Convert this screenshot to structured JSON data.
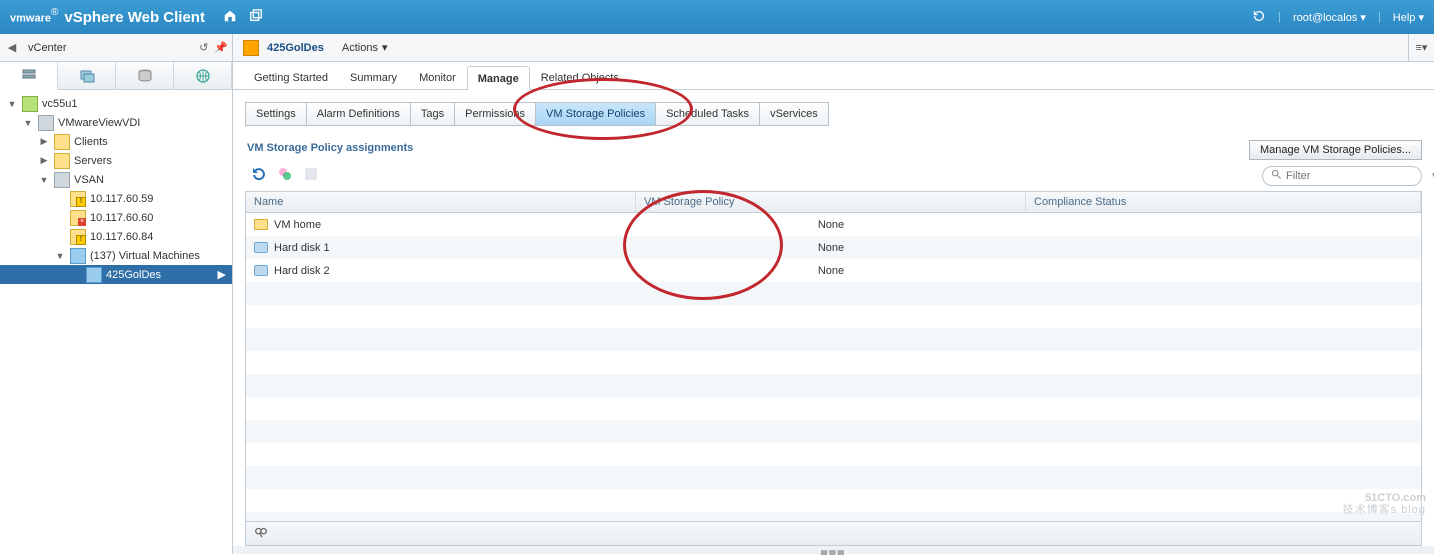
{
  "header": {
    "brand_prefix": "vm",
    "brand_suffix": "ware",
    "brand_reg": "®",
    "title": "vSphere Web Client",
    "user": "root@localos",
    "help": "Help"
  },
  "nav": {
    "back_label": "vCenter",
    "object_name": "425GolDes",
    "actions": "Actions"
  },
  "tree": [
    {
      "depth": 0,
      "tw": "▼",
      "icon": "ic-vc",
      "label": "vc55u1"
    },
    {
      "depth": 1,
      "tw": "▼",
      "icon": "ic-dc",
      "label": "VMwareViewVDI"
    },
    {
      "depth": 2,
      "tw": "▶",
      "icon": "ic-folder",
      "label": "Clients"
    },
    {
      "depth": 2,
      "tw": "▶",
      "icon": "ic-folder",
      "label": "Servers"
    },
    {
      "depth": 2,
      "tw": "▼",
      "icon": "ic-cluster",
      "label": "VSAN"
    },
    {
      "depth": 3,
      "tw": "",
      "icon": "ic-host warn",
      "label": "10.117.60.59"
    },
    {
      "depth": 3,
      "tw": "",
      "icon": "ic-host err",
      "label": "10.117.60.60"
    },
    {
      "depth": 3,
      "tw": "",
      "icon": "ic-host warn",
      "label": "10.117.60.84"
    },
    {
      "depth": 3,
      "tw": "▼",
      "icon": "ic-vmfolder",
      "label": "(137) Virtual Machines"
    },
    {
      "depth": 4,
      "tw": "",
      "icon": "ic-vm",
      "label": "425GolDes",
      "selected": true
    }
  ],
  "tabs1": [
    {
      "label": "Getting Started"
    },
    {
      "label": "Summary"
    },
    {
      "label": "Monitor"
    },
    {
      "label": "Manage",
      "active": true
    },
    {
      "label": "Related Objects"
    }
  ],
  "tabs2": [
    {
      "label": "Settings"
    },
    {
      "label": "Alarm Definitions"
    },
    {
      "label": "Tags"
    },
    {
      "label": "Permissions"
    },
    {
      "label": "VM Storage Policies",
      "active": true
    },
    {
      "label": "Scheduled Tasks"
    },
    {
      "label": "vServices"
    }
  ],
  "section_title": "VM Storage Policy assignments",
  "manage_btn": "Manage VM Storage Policies...",
  "filter_placeholder": "Filter",
  "grid": {
    "cols": [
      "Name",
      "VM Storage Policy",
      "Compliance Status"
    ],
    "rows": [
      {
        "icon": "ic-home",
        "name": "VM home",
        "policy": "None",
        "status": ""
      },
      {
        "icon": "ic-disk",
        "name": "Hard disk 1",
        "policy": "None",
        "status": ""
      },
      {
        "icon": "ic-disk",
        "name": "Hard disk 2",
        "policy": "None",
        "status": ""
      }
    ]
  },
  "watermark": {
    "line1": "51CTO.com",
    "line2": "技术博客s  blog"
  }
}
